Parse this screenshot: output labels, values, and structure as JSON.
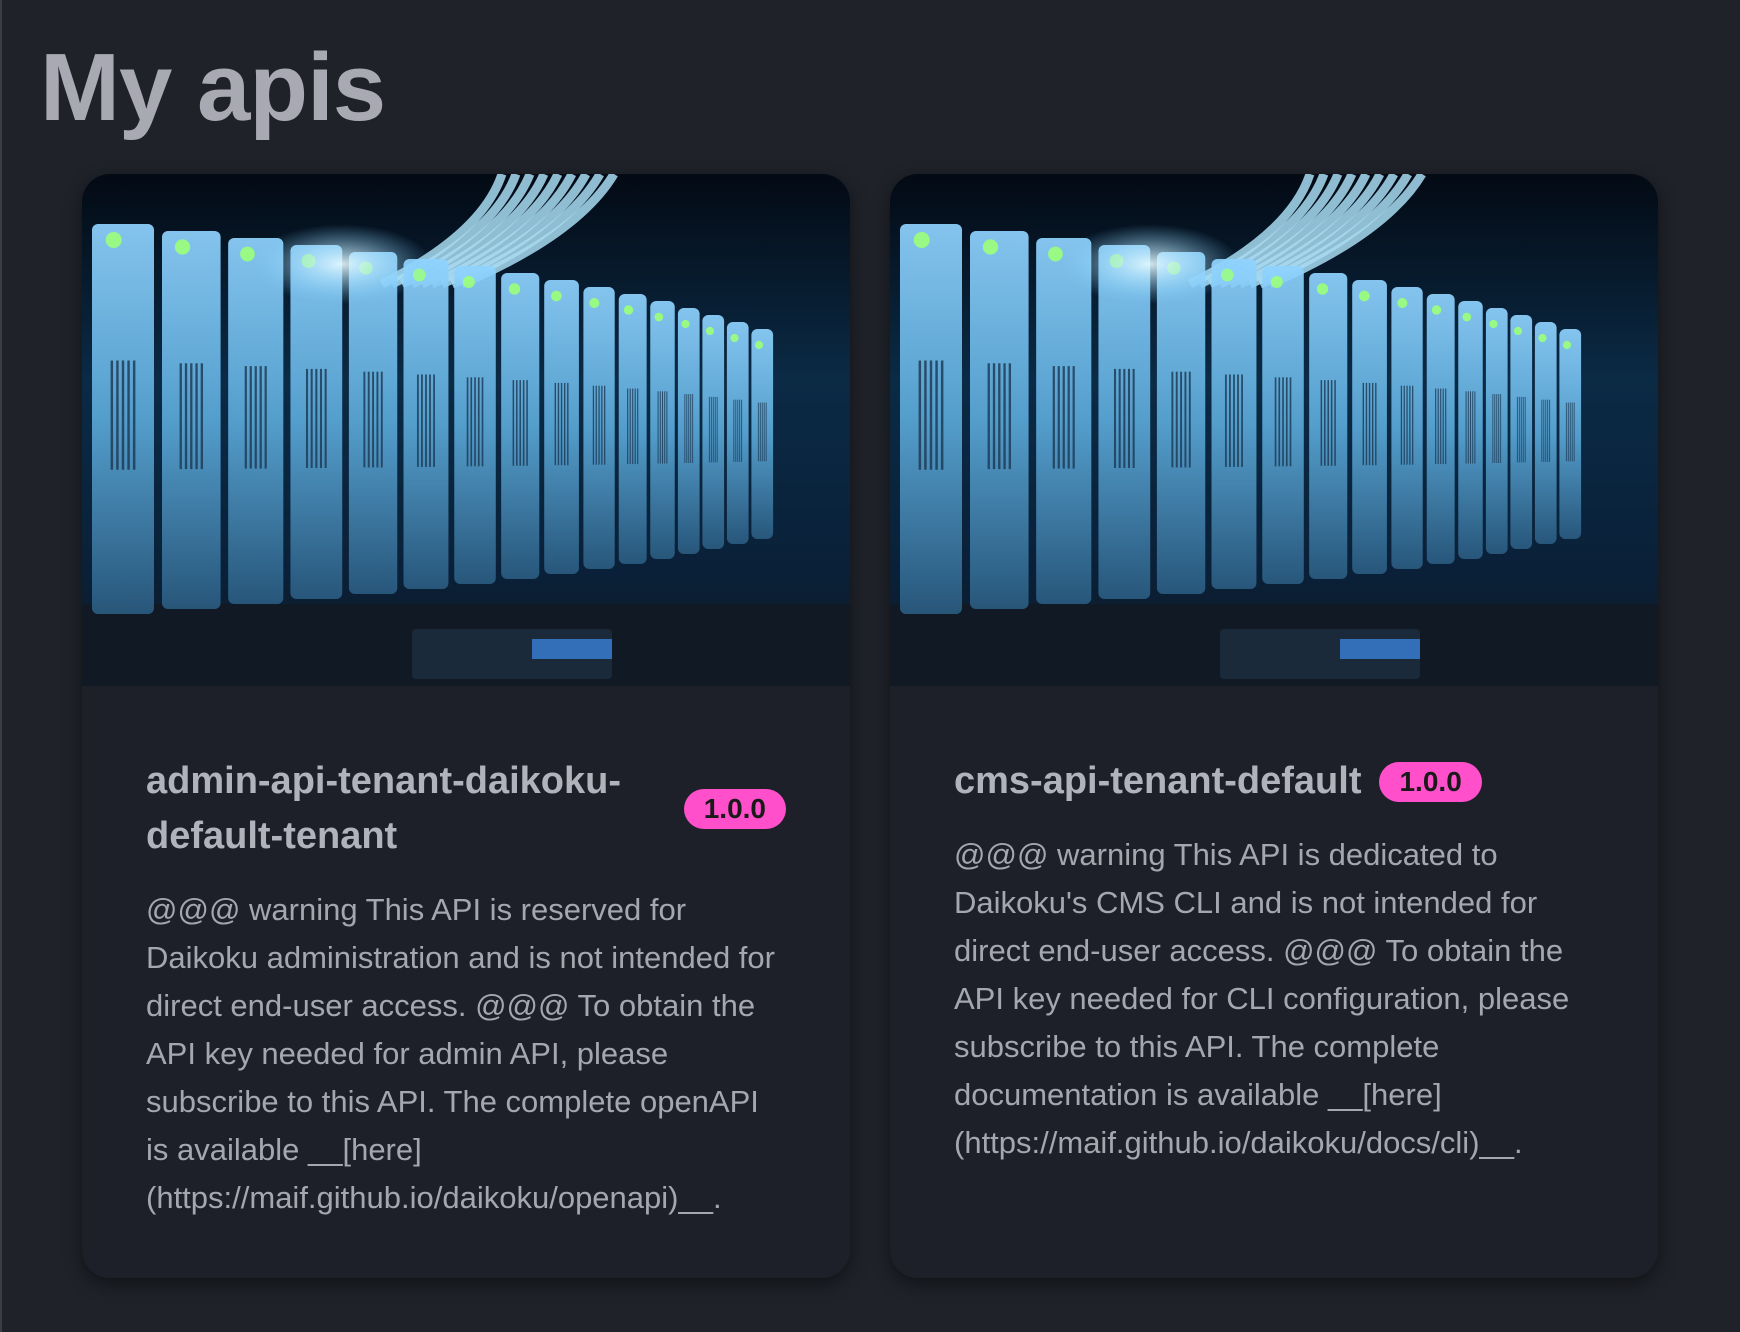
{
  "page": {
    "title": "My apis"
  },
  "cards": [
    {
      "title": "admin-api-tenant-daikoku-default-tenant",
      "version": "1.0.0",
      "description": "@@@ warning This API is reserved for Daikoku administration and is not intended for direct end-user access. @@@ To obtain the API key needed for admin API, please subscribe to this API. The complete openAPI is available __[here](https://maif.github.io/daikoku/openapi)__."
    },
    {
      "title": "cms-api-tenant-default",
      "version": "1.0.0",
      "description": "@@@ warning This API is dedicated to Daikoku's CMS CLI and is not intended for direct end-user access. @@@ To obtain the API key needed for CLI configuration, please subscribe to this API. The complete documentation is available __[here](https://maif.github.io/daikoku/docs/cli)__."
    }
  ],
  "colors": {
    "background": "#1f2229",
    "card": "#1d2028",
    "badge": "#ff4fcb",
    "title_text": "#a8a9b3"
  },
  "icons": {
    "card_image": "server-rack-image"
  }
}
